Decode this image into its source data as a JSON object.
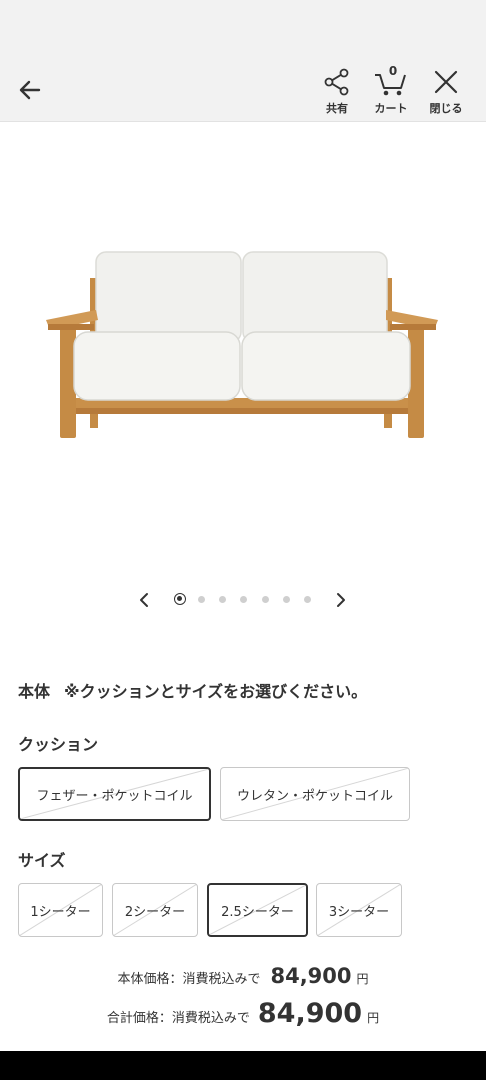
{
  "header": {
    "share_label": "共有",
    "cart_label": "カート",
    "cart_count": "0",
    "close_label": "閉じる"
  },
  "product": {
    "image_alt": "ソファ",
    "image_count": 7,
    "active_image_index": 0
  },
  "options": {
    "section_title": "本体",
    "section_note": "※クッションとサイズをお選びください。",
    "cushion_label": "クッション",
    "cushion_choices": [
      "フェザー・ポケットコイル",
      "ウレタン・ポケットコイル"
    ],
    "size_label": "サイズ",
    "size_choices": [
      "1シーター",
      "2シーター",
      "2.5シーター",
      "3シーター"
    ]
  },
  "price": {
    "body_label": "本体価格：消費税込みで",
    "body_value": "84,900",
    "total_label": "合計価格：消費税込みで",
    "total_value": "84,900",
    "unit": "円"
  },
  "colors": {
    "frame_wood": "#c9904a",
    "cushion_fabric": "#f1f1ee",
    "text": "#333333",
    "header_bg": "#f2f2f2"
  }
}
